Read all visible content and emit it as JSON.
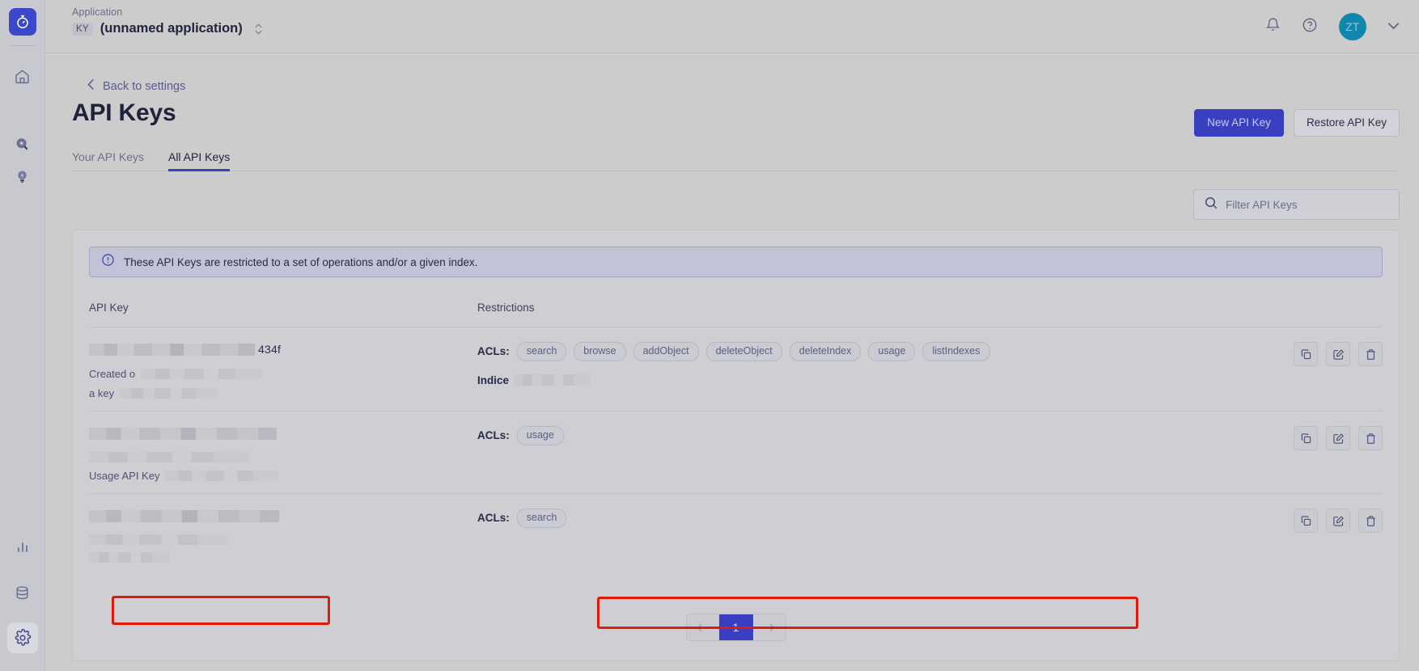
{
  "rail": {
    "logo_icon": "stopwatch-logo-icon",
    "items": [
      {
        "icon": "home-icon",
        "name": "home",
        "active": false
      },
      {
        "icon": "search-icon",
        "name": "search",
        "active": false
      },
      {
        "icon": "lightbulb-icon",
        "name": "insights",
        "active": false
      }
    ],
    "bottom_items": [
      {
        "icon": "bar-chart-icon",
        "name": "analytics",
        "active": false
      },
      {
        "icon": "database-icon",
        "name": "data-sources",
        "active": false
      },
      {
        "icon": "gear-icon",
        "name": "settings",
        "active": true
      }
    ]
  },
  "topbar": {
    "application_label": "Application",
    "app_badge": "KY",
    "app_name": "(unnamed application)",
    "app_switcher_icon": "up-down-chevrons-icon",
    "notifications_icon": "bell-icon",
    "help_icon": "question-circle-icon",
    "avatar_initials": "ZT",
    "avatar_chevron_icon": "chevron-down-icon",
    "avatar_color": "#1088ad"
  },
  "page": {
    "back_link": "Back to settings",
    "back_icon": "chevron-left-icon",
    "title": "API Keys",
    "accent_color": "#3a3fc2"
  },
  "header_actions": {
    "new_key_label": "New API Key",
    "restore_key_label": "Restore API Key"
  },
  "tabs": [
    {
      "label": "Your API Keys",
      "active": false
    },
    {
      "label": "All API Keys",
      "active": true
    }
  ],
  "filter": {
    "icon": "search-icon",
    "placeholder": "Filter API Keys",
    "value": ""
  },
  "notice": {
    "icon": "info-circle-icon",
    "text": "These API Keys are restricted to a set of operations and/or a given index."
  },
  "table": {
    "columns": [
      "API Key",
      "Restrictions"
    ],
    "acls_label": "ACLs:",
    "indices_label": "Indice",
    "rows": [
      {
        "key_suffix": "434f",
        "key_redacted": true,
        "meta_line1": "Created o",
        "meta_line2": "a key",
        "acls": [
          "search",
          "browse",
          "addObject",
          "deleteObject",
          "deleteIndex",
          "usage",
          "listIndexes"
        ],
        "has_indices": true,
        "actions": [
          "copy-icon",
          "edit-icon",
          "delete-icon"
        ]
      },
      {
        "key_suffix": "",
        "key_redacted": true,
        "meta_line1": "",
        "meta_line2": "Usage API Key",
        "acls": [
          "usage"
        ],
        "has_indices": false,
        "actions": [
          "copy-icon",
          "edit-icon",
          "delete-icon"
        ]
      },
      {
        "key_suffix": "",
        "key_redacted": true,
        "meta_line1": "",
        "meta_line2": "",
        "acls": [
          "search"
        ],
        "has_indices": false,
        "actions": [
          "copy-icon",
          "edit-icon",
          "delete-icon"
        ]
      }
    ]
  },
  "pagination": {
    "prev_icon": "arrow-left-icon",
    "next_icon": "arrow-right-icon",
    "current_page": "1"
  },
  "annotations": [
    {
      "name": "api-key-highlight",
      "color": "#e01b0c"
    },
    {
      "name": "acls-highlight",
      "color": "#e01b0c"
    }
  ]
}
